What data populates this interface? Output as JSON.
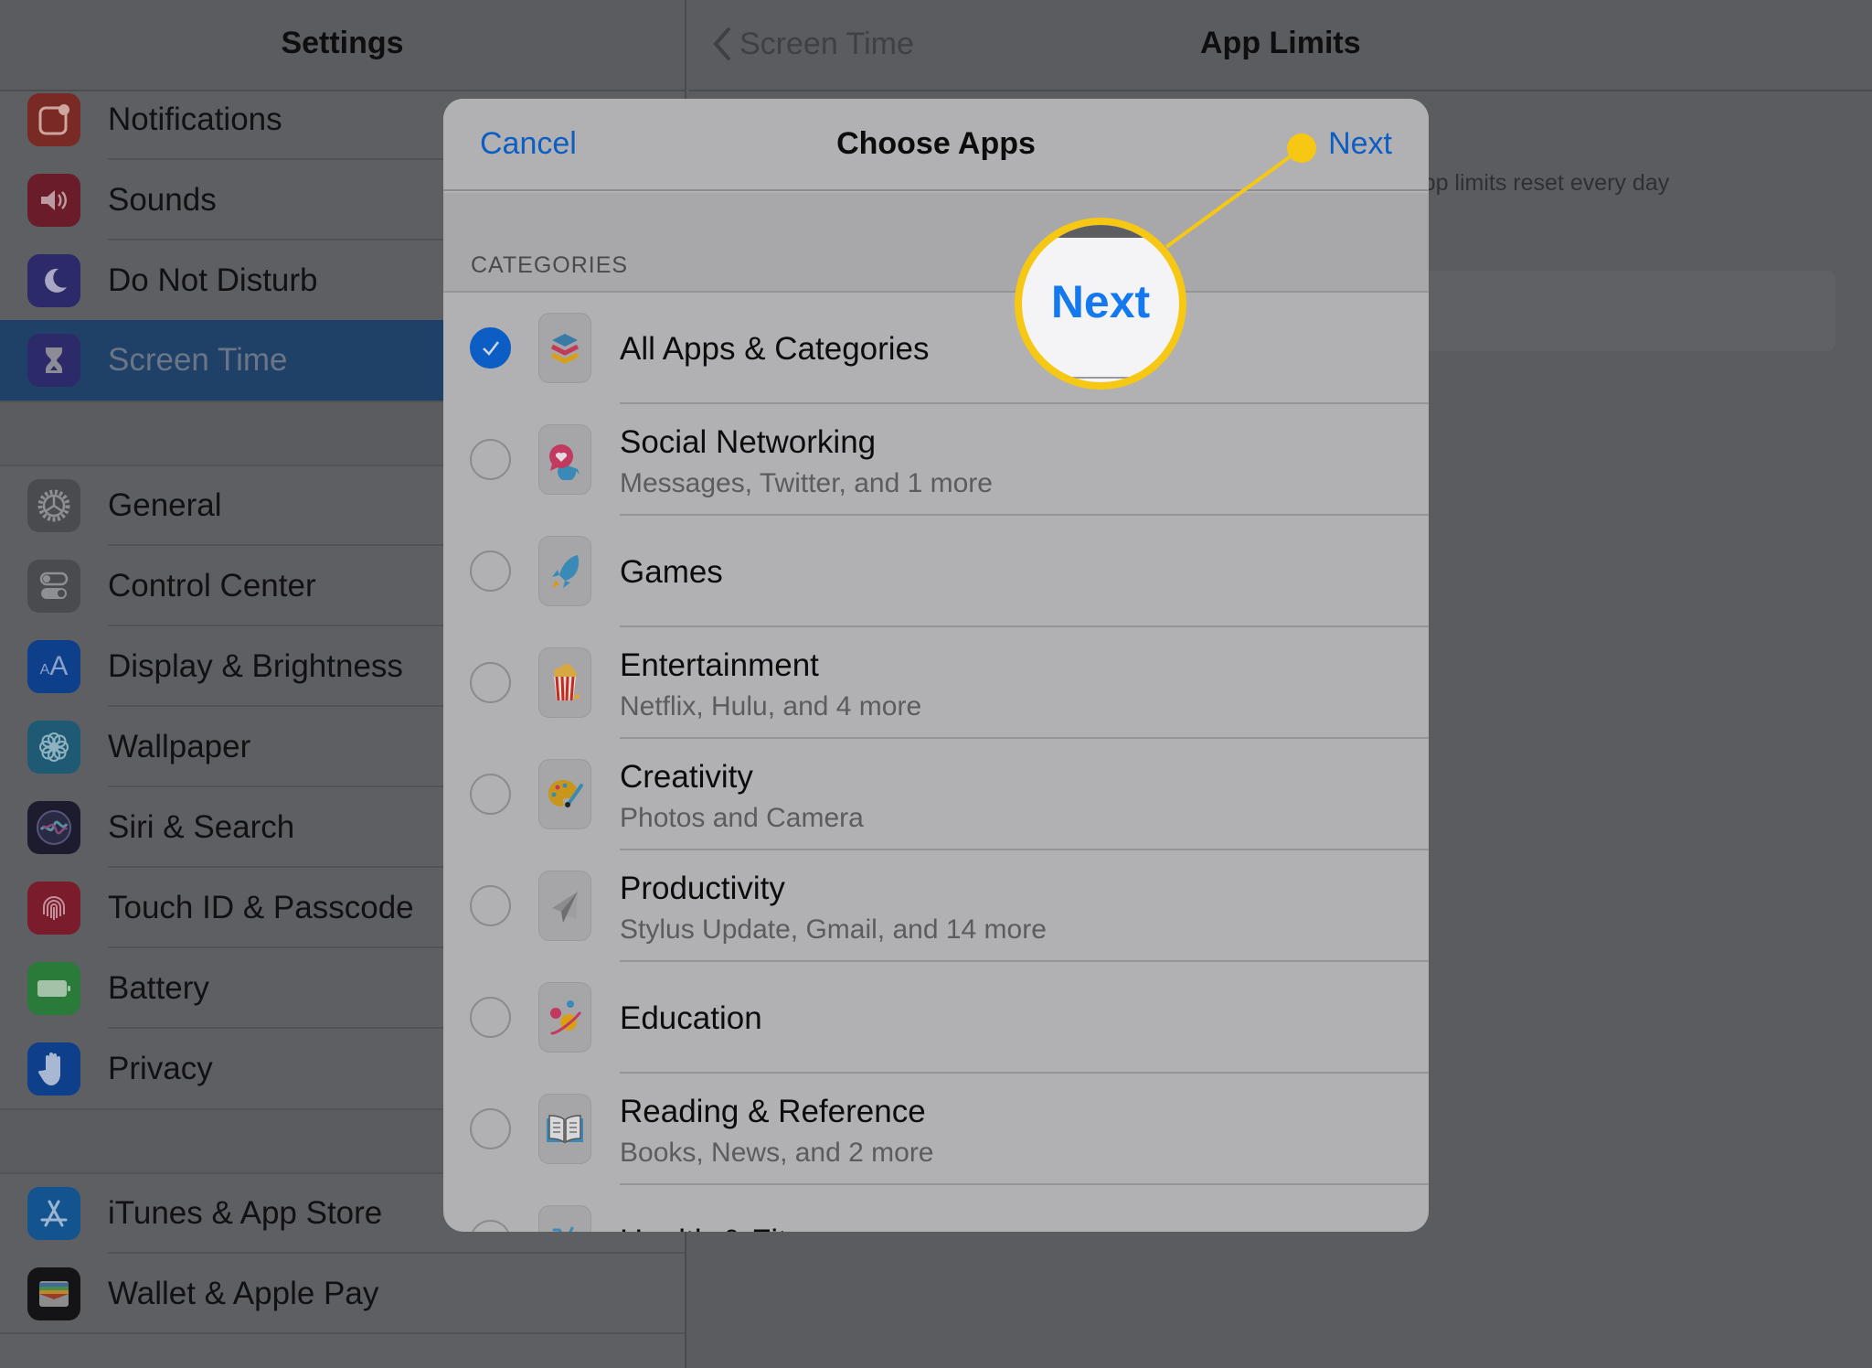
{
  "sidebar": {
    "title": "Settings",
    "groups": [
      [
        {
          "label": "Notifications",
          "icon": "notifications-icon",
          "color": "#7a2a24"
        },
        {
          "label": "Sounds",
          "icon": "speaker-icon",
          "color": "#6b1c2a"
        },
        {
          "label": "Do Not Disturb",
          "icon": "moon-icon",
          "color": "#2d2a6a"
        },
        {
          "label": "Screen Time",
          "icon": "hourglass-icon",
          "color": "#2d2a6a",
          "selected": true
        }
      ],
      [
        {
          "label": "General",
          "icon": "gear-icon",
          "color": "#4a4b4f"
        },
        {
          "label": "Control Center",
          "icon": "toggles-icon",
          "color": "#4a4b4f"
        },
        {
          "label": "Display & Brightness",
          "icon": "text-size-icon",
          "color": "#0d3f8a"
        },
        {
          "label": "Wallpaper",
          "icon": "flower-icon",
          "color": "#1f5a74"
        },
        {
          "label": "Siri & Search",
          "icon": "siri-icon",
          "color": "#1c1c2e"
        },
        {
          "label": "Touch ID & Passcode",
          "icon": "fingerprint-icon",
          "color": "#7a1c2c"
        },
        {
          "label": "Battery",
          "icon": "battery-icon",
          "color": "#2a7a3a"
        },
        {
          "label": "Privacy",
          "icon": "hand-icon",
          "color": "#0d3f8a"
        }
      ],
      [
        {
          "label": "iTunes & App Store",
          "icon": "app-store-icon",
          "color": "#14548e"
        },
        {
          "label": "Wallet & Apple Pay",
          "icon": "wallet-icon",
          "color": "#141416"
        }
      ]
    ]
  },
  "detail": {
    "back_label": "Screen Time",
    "title": "App Limits",
    "hint": "App limits reset every day"
  },
  "modal": {
    "cancel_label": "Cancel",
    "title": "Choose Apps",
    "next_label": "Next",
    "section_label": "CATEGORIES",
    "categories": [
      {
        "title": "All Apps & Categories",
        "subtitle": "",
        "icon": "stack-icon",
        "checked": true
      },
      {
        "title": "Social Networking",
        "subtitle": "Messages, Twitter, and 1 more",
        "icon": "chat-bubbles-icon",
        "checked": false
      },
      {
        "title": "Games",
        "subtitle": "",
        "icon": "rocket-icon",
        "checked": false
      },
      {
        "title": "Entertainment",
        "subtitle": "Netflix, Hulu, and 4 more",
        "icon": "popcorn-icon",
        "checked": false
      },
      {
        "title": "Creativity",
        "subtitle": "Photos and Camera",
        "icon": "palette-icon",
        "checked": false
      },
      {
        "title": "Productivity",
        "subtitle": "Stylus Update, Gmail, and 14 more",
        "icon": "paper-plane-icon",
        "checked": false
      },
      {
        "title": "Education",
        "subtitle": "",
        "icon": "planet-icon",
        "checked": false
      },
      {
        "title": "Reading & Reference",
        "subtitle": "Books, News, and 2 more",
        "icon": "book-icon",
        "checked": false
      },
      {
        "title": "Health & Fitness",
        "subtitle": "",
        "icon": "bike-icon",
        "checked": false
      }
    ]
  },
  "callout": {
    "label": "Next",
    "color": "#f6c813"
  },
  "colors": {
    "accent": "#0c5dc4",
    "selected_row": "#1f4067"
  }
}
